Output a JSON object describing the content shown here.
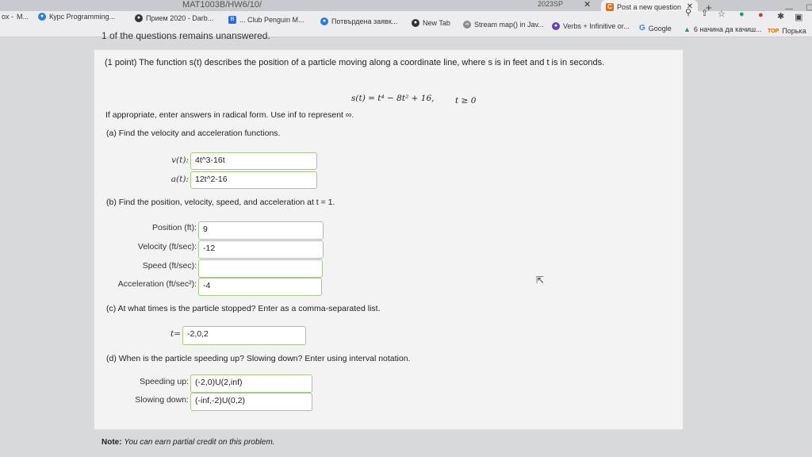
{
  "browser": {
    "url_fragment": "MAT1003B/HW6/10/",
    "url_fragment2": "2023SP",
    "active_tab_title": "Post a new question",
    "active_tab_icon": "C",
    "bookmarks": [
      {
        "label": "M...",
        "prefix": "ox -"
      },
      {
        "label": "Курс Programming..."
      },
      {
        "label": "Прием 2020 - Darb..."
      },
      {
        "label": "... Club Penguin M..."
      },
      {
        "label": "Потвърдена заявк..."
      },
      {
        "label": "New Tab"
      },
      {
        "label": "Stream map() in Jav..."
      },
      {
        "label": "Verbs + Infinitive or..."
      },
      {
        "label": "Google"
      },
      {
        "label": "6 начина да качиш..."
      },
      {
        "label": "Порька"
      }
    ]
  },
  "status": "1 of the questions remains unanswered.",
  "problem": {
    "intro": "(1 point) The function s(t) describes the position of a particle moving along a coordinate line, where s is in feet and t is in seconds.",
    "formula": "s(t) = t⁴ − 8t² + 16,",
    "domain": "t ≥ 0",
    "instructions": "If appropriate, enter answers in radical form. Use inf to represent ∞.",
    "part_a": {
      "prompt": "(a) Find the velocity and acceleration functions.",
      "v_label": "v(t):",
      "v_value": "4t^3-16t",
      "a_label": "a(t):",
      "a_value": "12t^2-16"
    },
    "part_b": {
      "prompt": "(b) Find the position, velocity, speed, and acceleration at t = 1.",
      "position_label": "Position (ft):",
      "position_value": "9",
      "velocity_label": "Velocity (ft/sec):",
      "velocity_value": "-12",
      "speed_label": "Speed (ft/sec):",
      "speed_value": "",
      "accel_label": "Acceleration (ft/sec²):",
      "accel_value": "-4"
    },
    "part_c": {
      "prompt": "(c) At what times is the particle stopped? Enter as a comma-separated list.",
      "t_label": "t=",
      "t_value": "-2,0,2"
    },
    "part_d": {
      "prompt": "(d) When is the particle speeding up? Slowing down? Enter using interval notation.",
      "up_label": "Speeding up:",
      "up_value": "(-2,0)U(2,inf)",
      "down_label": "Slowing down:",
      "down_value": "(-inf,-2)U(0,2)"
    },
    "note_bold": "Note:",
    "note_text": "You can earn partial credit on this problem."
  },
  "colors": {
    "accent_field_border": "#a6c98a",
    "panel_bg": "#f3f3f4"
  }
}
